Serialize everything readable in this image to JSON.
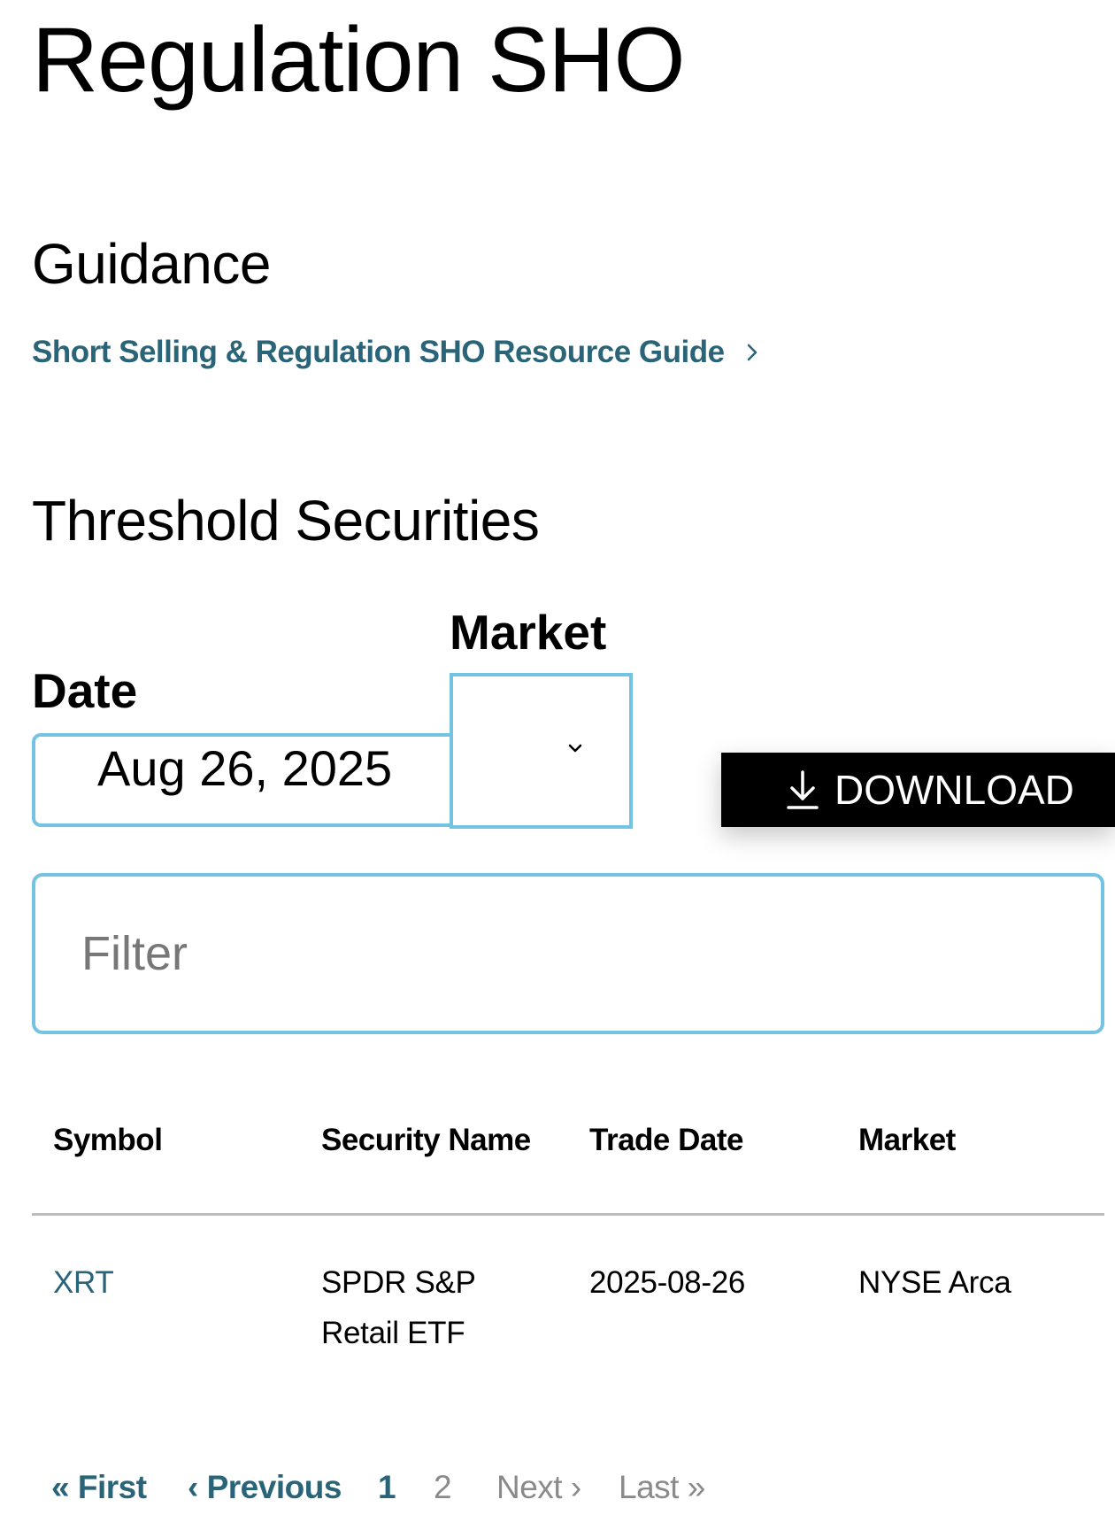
{
  "page_title": "Regulation SHO",
  "guidance": {
    "heading": "Guidance",
    "link_label": "Short Selling & Regulation SHO Resource Guide"
  },
  "threshold": {
    "heading": "Threshold Securities",
    "date_label": "Date",
    "date_value": "Aug 26, 2025",
    "market_label": "Market",
    "market_value": "",
    "download_label": "DOWNLOAD",
    "filter_placeholder": "Filter"
  },
  "table": {
    "headers": [
      "Symbol",
      "Security Name",
      "Trade Date",
      "Market"
    ],
    "rows": [
      {
        "symbol": "XRT",
        "security_name": "SPDR S&P Retail ETF",
        "trade_date": "2025-08-26",
        "market": "NYSE Arca"
      }
    ]
  },
  "pagination": {
    "first": "« First",
    "previous": "‹ Previous",
    "pages": [
      "1",
      "2"
    ],
    "current_page": "1",
    "next": "Next ›",
    "last": "Last »"
  },
  "colors": {
    "link": "#2a6478",
    "input_border": "#74c3e3",
    "button_bg": "#000000",
    "disabled_text": "#8a8a8a",
    "divider": "#bdbdbd"
  },
  "icons": {
    "resource_link": "chevron-right-icon",
    "market_select": "chevron-down-icon",
    "download": "download-icon"
  }
}
